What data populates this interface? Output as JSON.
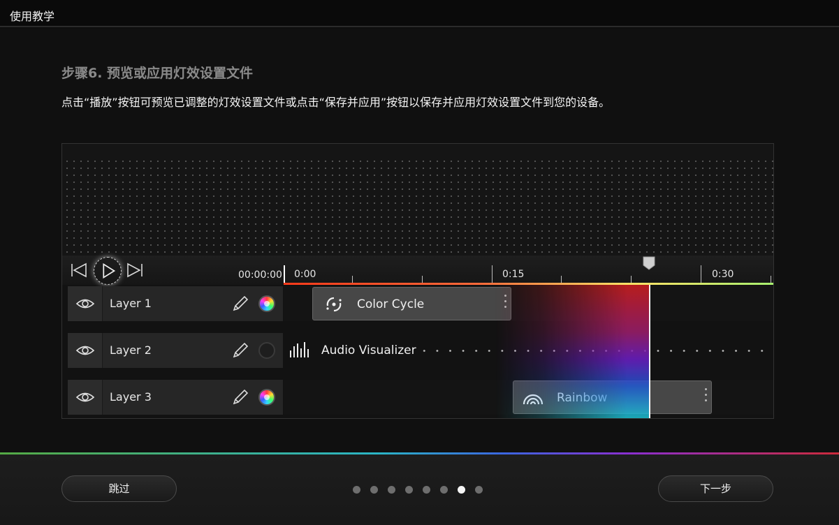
{
  "window": {
    "title": "使用教学"
  },
  "step": {
    "title": "步骤6. 预览或应用灯效设置文件",
    "description": "点击“播放”按钮可预览已调整的灯效设置文件或点击“保存并应用”按钮以保存并应用灯效设置文件到您的设备。"
  },
  "timeline": {
    "timecode": "00:00:00",
    "ruler_labels": [
      "0:00",
      "0:15",
      "0:30"
    ],
    "layers": [
      {
        "name": "Layer 1",
        "swatch": "color",
        "clip": "Color Cycle",
        "clip_icon": "color-cycle-icon"
      },
      {
        "name": "Layer 2",
        "swatch": "dark",
        "clip": "Audio Visualizer",
        "clip_icon": "audio-bars-icon"
      },
      {
        "name": "Layer 3",
        "swatch": "color",
        "clip": "Rainbow",
        "clip_icon": "rainbow-icon"
      }
    ]
  },
  "footer": {
    "skip_label": "跳过",
    "next_label": "下一步",
    "page_count": 8,
    "current_page": 7
  },
  "colors": {
    "background": "#101010",
    "clip": "#474747",
    "sweep_top": "#c81e1e",
    "sweep_bottom": "#1ec8d2"
  }
}
